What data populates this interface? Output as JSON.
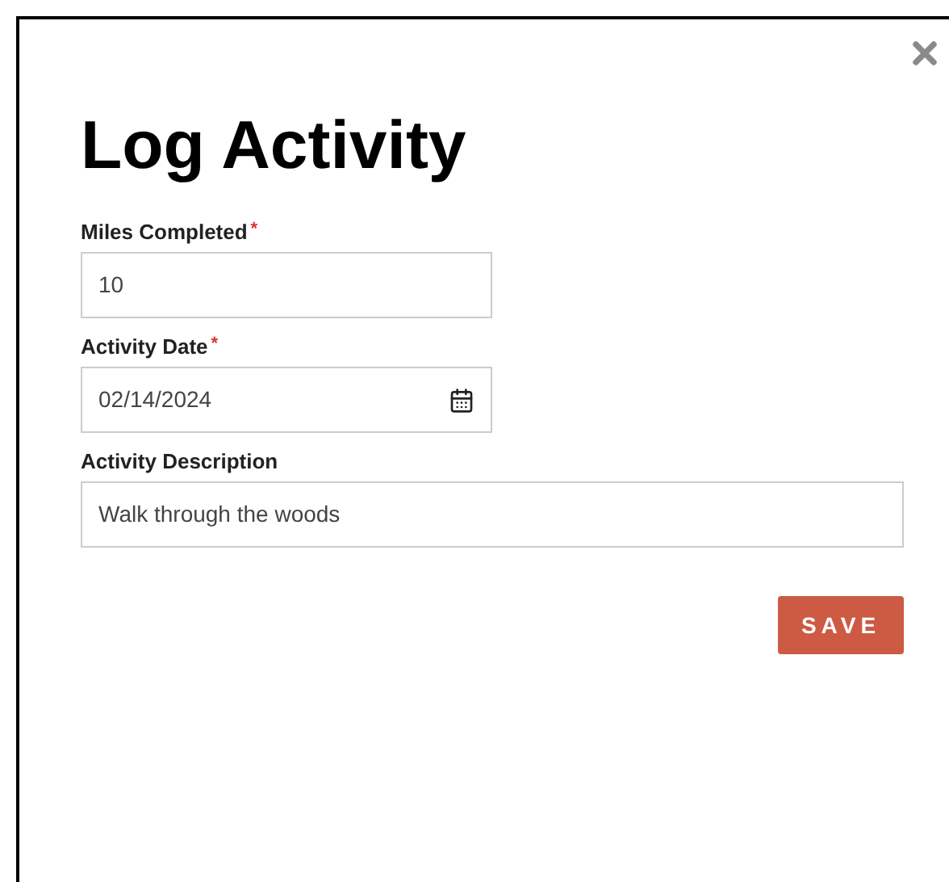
{
  "dialog": {
    "title": "Log Activity",
    "fields": [
      {
        "label": "Miles Completed",
        "required_mark": "*",
        "value": "10",
        "kind": "text"
      },
      {
        "label": "Activity Date",
        "required_mark": "*",
        "value": "02/14/2024",
        "kind": "date"
      },
      {
        "label": "Activity Description",
        "value": "Walk through the woods",
        "kind": "wide"
      }
    ],
    "button": "SAVE"
  }
}
